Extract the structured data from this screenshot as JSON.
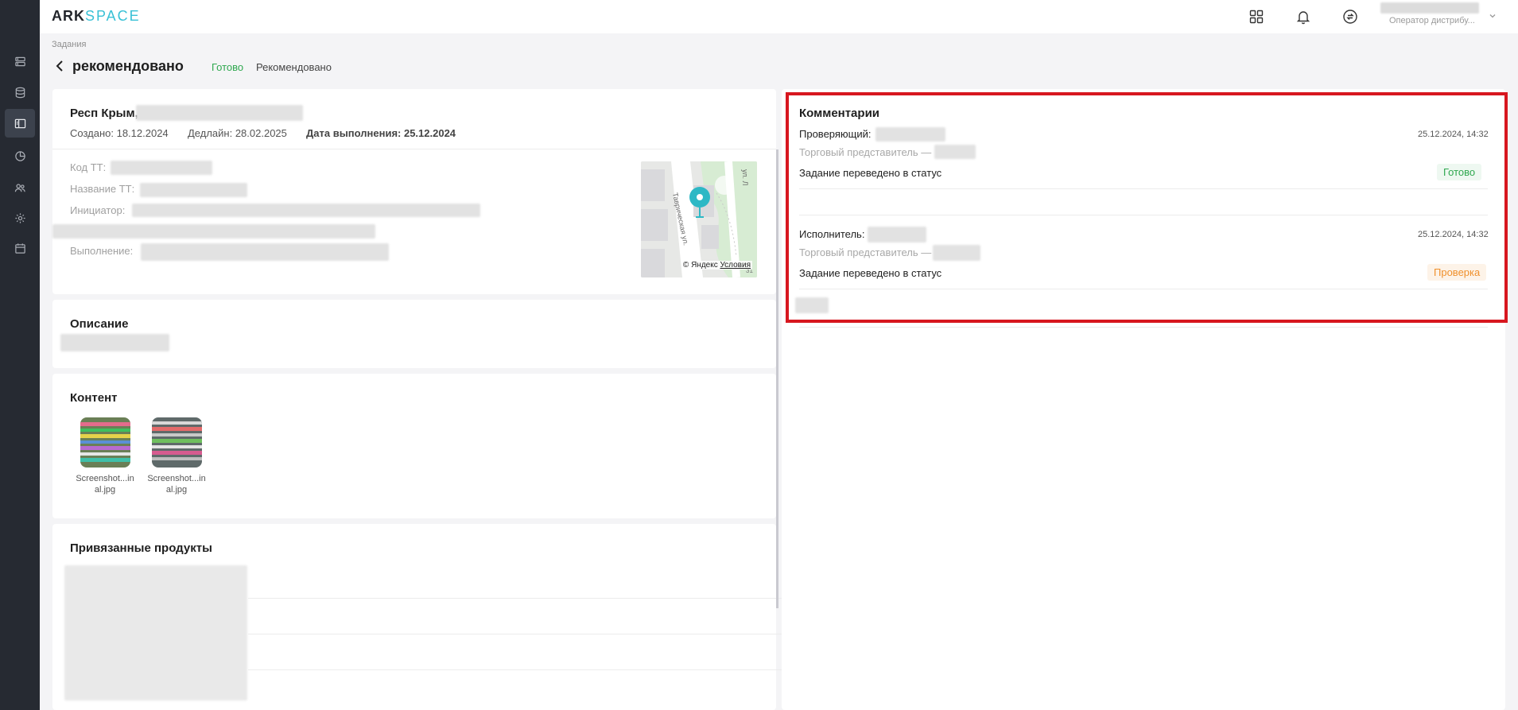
{
  "app": {
    "logo_ark": "ARK",
    "logo_space": "SPACE"
  },
  "sidebar": {
    "items": [
      {
        "icon": "server-icon"
      },
      {
        "icon": "database-icon"
      },
      {
        "icon": "tasks-panel-icon",
        "active": true
      },
      {
        "icon": "analytics-pie-icon"
      },
      {
        "icon": "users-icon"
      },
      {
        "icon": "settings-icon"
      },
      {
        "icon": "calendar-icon"
      }
    ]
  },
  "header": {
    "user_role": "Оператор дистрибу..."
  },
  "breadcrumb": "Задания",
  "page": {
    "title": "рекомендовано",
    "status_primary": "Готово",
    "status_secondary": "Рекомендовано"
  },
  "task": {
    "location": "Респ Крым,",
    "created": "Создано: 18.12.2024",
    "deadline": "Дедлайн: 28.02.2025",
    "done_label": "Дата выполнения: 25.12.2024",
    "fields": {
      "code_label": "Код ТТ:",
      "name_label": "Название ТТ:",
      "initiator_label": "Инициатор:",
      "execution_label": "Выполнение:"
    },
    "map": {
      "street": "Таврическая ул.",
      "copyright": "© Яндекс",
      "terms": "Условия",
      "house": "31"
    }
  },
  "description": {
    "title": "Описание"
  },
  "content": {
    "title": "Контент",
    "files": [
      {
        "name_line1": "Screenshot...in",
        "name_line2": "al.jpg"
      },
      {
        "name_line1": "Screenshot...in",
        "name_line2": "al.jpg"
      }
    ]
  },
  "products": {
    "title": "Привязанные продукты"
  },
  "comments": {
    "title": "Комментарии",
    "items": [
      {
        "role": "Проверяющий:",
        "sub": "Торговый представитель —",
        "date": "25.12.2024, 14:32",
        "text": "Задание переведено в статус",
        "status": "Готово",
        "status_color": "#2fa84f"
      },
      {
        "role": "Исполнитель:",
        "sub": "Торговый представитель —",
        "date": "25.12.2024, 14:32",
        "text": "Задание переведено в статус",
        "status": "Проверка",
        "status_color": "#f0902c"
      }
    ]
  }
}
